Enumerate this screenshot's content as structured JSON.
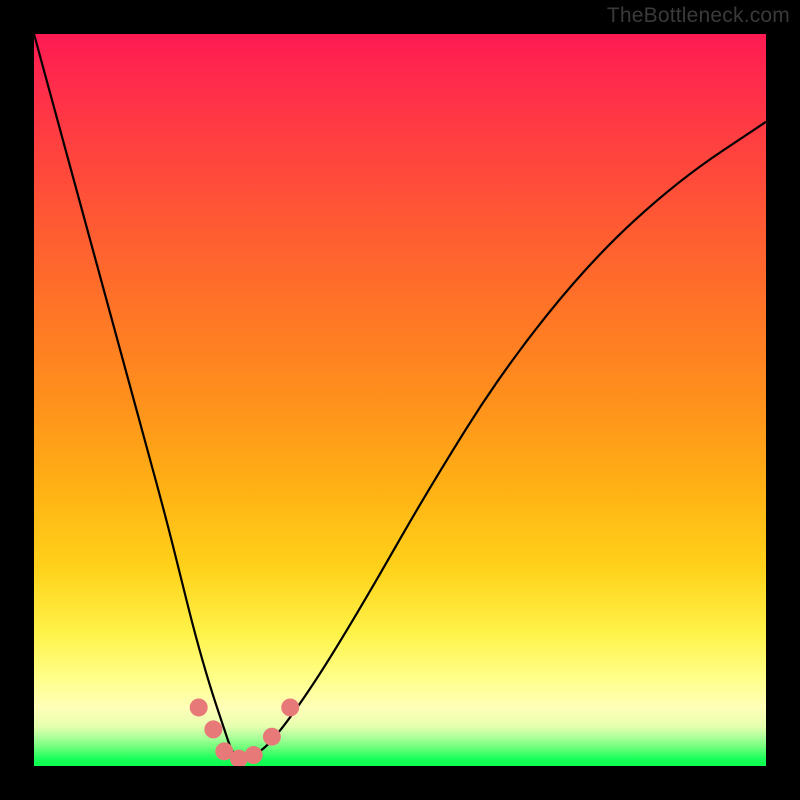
{
  "watermark": "TheBottleneck.com",
  "chart_data": {
    "type": "line",
    "title": "",
    "xlabel": "",
    "ylabel": "",
    "xlim": [
      0,
      100
    ],
    "ylim": [
      0,
      100
    ],
    "background_gradient": {
      "top_color": "#ff1a52",
      "mid_color": "#ffd21a",
      "bottom_color": "#0aff4e",
      "meaning": "red=bad / green=good"
    },
    "series": [
      {
        "name": "bottleneck-curve",
        "color": "#000000",
        "x": [
          0,
          3,
          6,
          9,
          12,
          15,
          18,
          20,
          22,
          24,
          26,
          27,
          28,
          29,
          31,
          33,
          36,
          40,
          46,
          54,
          64,
          76,
          88,
          100
        ],
        "y": [
          100,
          89,
          78,
          67,
          56,
          45,
          34,
          26,
          18,
          11,
          5,
          2,
          1,
          1,
          2,
          4,
          8,
          14,
          24,
          38,
          54,
          69,
          80,
          88
        ]
      }
    ],
    "markers": [
      {
        "name": "marker-1",
        "x": 22.5,
        "y": 8,
        "color": "#e77a78"
      },
      {
        "name": "marker-2",
        "x": 24.5,
        "y": 5,
        "color": "#e77a78"
      },
      {
        "name": "marker-3",
        "x": 26.0,
        "y": 2,
        "color": "#e77a78"
      },
      {
        "name": "marker-4",
        "x": 28.0,
        "y": 1,
        "color": "#e77a78"
      },
      {
        "name": "marker-5",
        "x": 30.0,
        "y": 1.5,
        "color": "#e77a78"
      },
      {
        "name": "marker-6",
        "x": 32.5,
        "y": 4,
        "color": "#e77a78"
      },
      {
        "name": "marker-7",
        "x": 35.0,
        "y": 8,
        "color": "#e77a78"
      }
    ]
  }
}
